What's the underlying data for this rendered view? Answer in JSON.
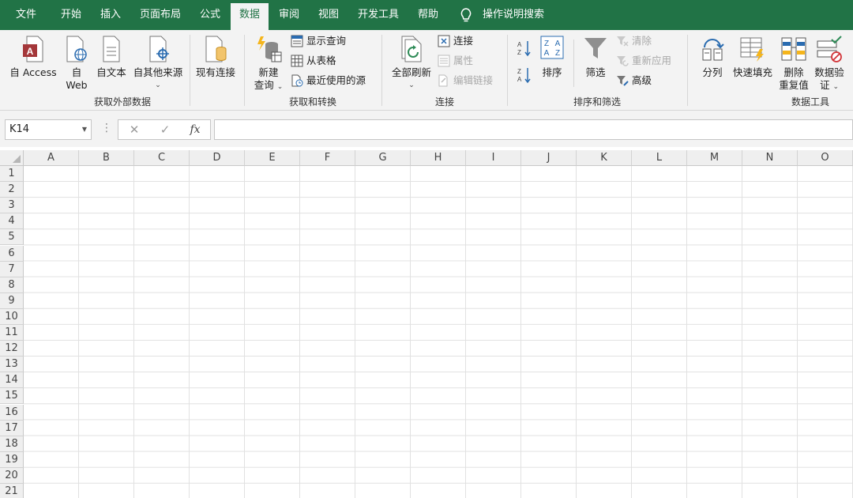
{
  "tabs": [
    {
      "label": "文件",
      "active": false
    },
    {
      "label": "开始",
      "active": false
    },
    {
      "label": "插入",
      "active": false
    },
    {
      "label": "页面布局",
      "active": false
    },
    {
      "label": "公式",
      "active": false
    },
    {
      "label": "数据",
      "active": true
    },
    {
      "label": "审阅",
      "active": false
    },
    {
      "label": "视图",
      "active": false
    },
    {
      "label": "开发工具",
      "active": false
    },
    {
      "label": "帮助",
      "active": false
    }
  ],
  "tell_me": "操作说明搜索",
  "ribbon": {
    "external": {
      "label": "获取外部数据",
      "access": "自 Access",
      "web_line1": "自",
      "web_line2": "Web",
      "text": "自文本",
      "other": "自其他来源",
      "existing": "现有连接"
    },
    "transform": {
      "label": "获取和转换",
      "new_query_line1": "新建",
      "new_query_line2": "查询",
      "show_queries": "显示查询",
      "from_table": "从表格",
      "recent_sources": "最近使用的源"
    },
    "connections": {
      "label": "连接",
      "refresh_all": "全部刷新",
      "connections": "连接",
      "properties": "属性",
      "edit_links": "编辑链接"
    },
    "sort_filter": {
      "label": "排序和筛选",
      "sort": "排序",
      "filter": "筛选",
      "clear": "清除",
      "reapply": "重新应用",
      "advanced": "高级"
    },
    "tools": {
      "label": "数据工具",
      "text_to_columns": "分列",
      "flash_fill": "快速填充",
      "remove_dup_line1": "删除",
      "remove_dup_line2": "重复值",
      "validation_line1": "数据验",
      "validation_line2": "证"
    }
  },
  "formula_bar": {
    "name_box": "K14",
    "cancel_icon": "✕",
    "enter_icon": "✓",
    "fx_label": "fx",
    "formula": ""
  },
  "sheet": {
    "columns": [
      "A",
      "B",
      "C",
      "D",
      "E",
      "F",
      "G",
      "H",
      "I",
      "J",
      "K",
      "L",
      "M",
      "N",
      "O"
    ],
    "rows": [
      "1",
      "2",
      "3",
      "4",
      "5",
      "6",
      "7",
      "8",
      "9",
      "10",
      "11",
      "12",
      "13",
      "14",
      "15",
      "16",
      "17",
      "18",
      "19",
      "20",
      "21"
    ]
  },
  "colors": {
    "accent": "#217346",
    "ribbon_bg": "#f3f3f3",
    "access_red": "#a4373a"
  }
}
